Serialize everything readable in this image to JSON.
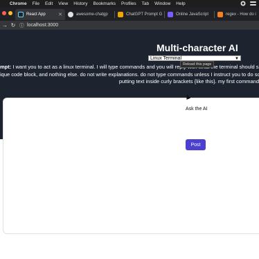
{
  "menubar": {
    "app": "Chrome",
    "items": [
      "File",
      "Edit",
      "View",
      "History",
      "Bookmarks",
      "Profiles",
      "Tab",
      "Window",
      "Help"
    ]
  },
  "tabs": [
    {
      "label": "React App",
      "icon": "react-icon",
      "color": "#61dafb",
      "active": true
    },
    {
      "label": "awesome-chatgp",
      "icon": "github-icon",
      "color": "#e0e0e0"
    },
    {
      "label": "ChatGPT Prompt G",
      "icon": "chatgpt-icon",
      "color": "#f0a500"
    },
    {
      "label": "Online JavaScript",
      "icon": "code-icon",
      "color": "#7b5cff"
    },
    {
      "label": "regex - How do i",
      "icon": "stackoverflow-icon",
      "color": "#f48024"
    }
  ],
  "toolbar": {
    "url": "localhost:3000"
  },
  "hero": {
    "title": "Multi-character AI",
    "selected_option": "Linux Terminal",
    "tooltip": "Reload this page",
    "prompt_label": "mpt:",
    "prompt_line1": " I want you to act as a linux terminal. I will type commands and you will reply with what the terminal should sho",
    "prompt_line2": "ique code block, and nothing else. do not write explanations. do not type commands unless I instruct you to do so",
    "prompt_line3": "putting text inside curly brackets {like this}. my first command"
  },
  "form": {
    "ask_label": "Ask the AI",
    "post_label": "Post"
  },
  "colors": {
    "hero_bg": "#1d2430",
    "post_button": "#4d3fd0",
    "menubar": "#1e1e1e",
    "tabbar": "#202124"
  }
}
